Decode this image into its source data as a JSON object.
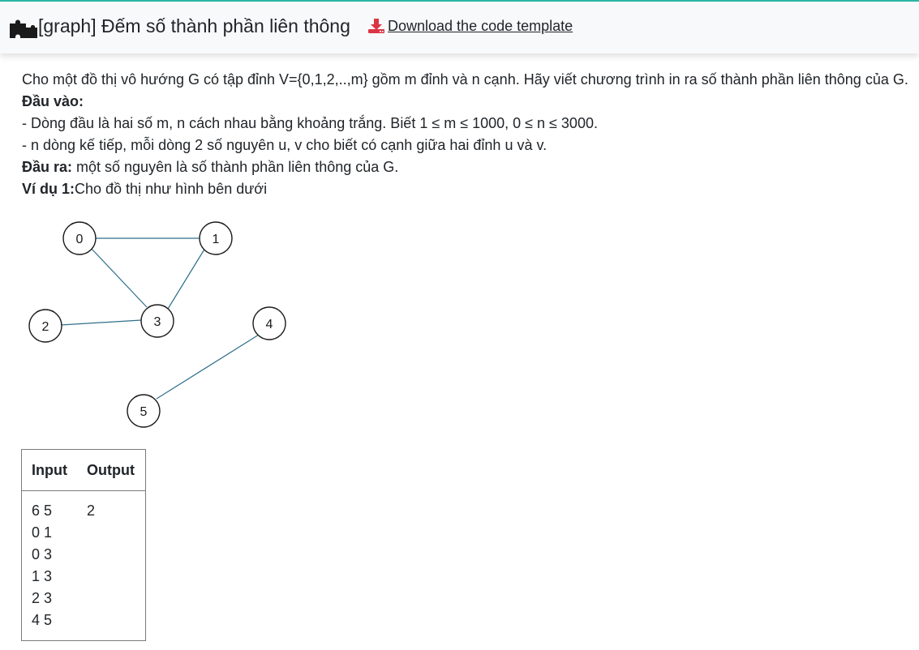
{
  "header": {
    "title": "[graph] Đếm số thành phần liên thông",
    "download_label": "Download the code template",
    "accent_color": "#2ab6a4",
    "download_icon_color": "#dc3545",
    "icons": [
      "puzzle-icon",
      "download-icon"
    ]
  },
  "problem": {
    "description": "Cho một đồ thị vô hướng G có tập đỉnh V={0,1,2,..,m} gồm m đỉnh và n cạnh. Hãy viết chương trình in ra số thành phần liên thông của G.",
    "input_heading": "Đầu vào:",
    "input_line1": "- Dòng đầu là hai số m, n cách nhau bằng khoảng trắng. Biết 1 ≤ m ≤ 1000, 0 ≤ n ≤ 3000.",
    "input_line2": "- n dòng kế tiếp, mỗi dòng 2 số nguyên u, v cho biết có cạnh giữa hai đỉnh u và v.",
    "output_heading": "Đầu ra:",
    "output_text": " một số nguyên là số thành phần liên thông của G.",
    "example_heading": "Ví dụ 1:",
    "example_text": "Cho đồ thị như hình bên dưới"
  },
  "graph": {
    "nodes": [
      "0",
      "1",
      "2",
      "3",
      "4",
      "5"
    ],
    "edges": [
      [
        "0",
        "1"
      ],
      [
        "0",
        "3"
      ],
      [
        "1",
        "3"
      ],
      [
        "2",
        "3"
      ],
      [
        "4",
        "5"
      ]
    ],
    "edge_color": "#2f6f8a"
  },
  "example_table": {
    "input_header": "Input",
    "output_header": "Output",
    "input_lines": [
      "6 5",
      "0 1",
      "0 3",
      "1 3",
      "2 3",
      "4 5"
    ],
    "output_value": "2"
  }
}
